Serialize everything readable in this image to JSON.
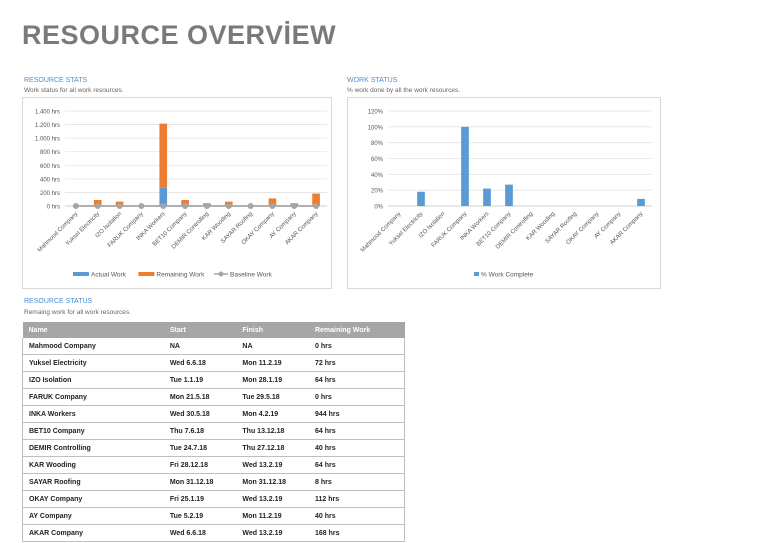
{
  "title": "RESOURCE OVERVİEW",
  "resource_stats": {
    "heading": "RESOURCE STATS",
    "subtitle": "Work status for all work resources."
  },
  "work_status": {
    "heading": "WORK STATUS",
    "subtitle": "% work done by all the work resources."
  },
  "resource_status": {
    "heading": "RESOURCE STATUS",
    "subtitle": "Remaing work for all work resources.",
    "columns": [
      "Name",
      "Start",
      "Finish",
      "Remaining Work"
    ],
    "rows": [
      [
        "Mahmood Company",
        "NA",
        "NA",
        "0 hrs"
      ],
      [
        "Yuksel Electricity",
        "Wed 6.6.18",
        "Mon 11.2.19",
        "72 hrs"
      ],
      [
        "IZO Isolation",
        "Tue 1.1.19",
        "Mon 28.1.19",
        "64 hrs"
      ],
      [
        "FARUK Company",
        "Mon 21.5.18",
        "Tue 29.5.18",
        "0 hrs"
      ],
      [
        "INKA Workers",
        "Wed 30.5.18",
        "Mon 4.2.19",
        "944 hrs"
      ],
      [
        "BET10 Company",
        "Thu 7.6.18",
        "Thu 13.12.18",
        "64 hrs"
      ],
      [
        "DEMIR Controlling",
        "Tue 24.7.18",
        "Thu 27.12.18",
        "40 hrs"
      ],
      [
        "KAR Wooding",
        "Fri 28.12.18",
        "Wed 13.2.19",
        "64 hrs"
      ],
      [
        "SAYAR Roofing",
        "Mon 31.12.18",
        "Mon 31.12.18",
        "8 hrs"
      ],
      [
        "OKAY Company",
        "Fri 25.1.19",
        "Wed 13.2.19",
        "112 hrs"
      ],
      [
        "AY Company",
        "Tue 5.2.19",
        "Mon 11.2.19",
        "40 hrs"
      ],
      [
        "AKAR Company",
        "Wed 6.6.18",
        "Wed 13.2.19",
        "168 hrs"
      ]
    ]
  },
  "chart_data": [
    {
      "type": "bar",
      "stacked": true,
      "categories": [
        "Mahmood Company",
        "Yuksel Electricity",
        "IZO Isolation",
        "FARUK Company",
        "INKA Workers",
        "BET10 Company",
        "DEMIR Controlling",
        "KAR Wooding",
        "SAYAR Roofing",
        "OKAY Company",
        "AY Company",
        "AKAR Company"
      ],
      "series": [
        {
          "name": "Actual Work",
          "color": "#5b9bd5",
          "values": [
            0,
            16,
            0,
            0,
            270,
            24,
            0,
            0,
            0,
            0,
            0,
            16
          ]
        },
        {
          "name": "Remaining Work",
          "color": "#ed7d31",
          "values": [
            0,
            72,
            64,
            0,
            944,
            64,
            40,
            64,
            8,
            112,
            40,
            168
          ]
        },
        {
          "name": "Baseline Work",
          "color": "#a5a5a5",
          "type": "line",
          "values": [
            0,
            0,
            0,
            0,
            0,
            0,
            0,
            0,
            0,
            0,
            0,
            0
          ]
        }
      ],
      "yticks": [
        "0 hrs",
        "200 hrs",
        "400 hrs",
        "600 hrs",
        "800 hrs",
        "1.000 hrs",
        "1.200 hrs",
        "1.400 hrs"
      ],
      "ylim": [
        0,
        1400
      ],
      "legend": "bottom"
    },
    {
      "type": "bar",
      "categories": [
        "Mahmood Company",
        "Yuksel Electricity",
        "IZO Isolation",
        "FARUK Company",
        "INKA Workers",
        "BET10 Company",
        "DEMIR Controlling",
        "KAR Wooding",
        "SAYAR Roofing",
        "OKAY Company",
        "AY Company",
        "AKAR Company"
      ],
      "series": [
        {
          "name": "% Work Complete",
          "color": "#5b9bd5",
          "values": [
            0,
            18,
            0,
            100,
            22,
            27,
            0,
            0,
            0,
            0,
            0,
            9
          ]
        }
      ],
      "yticks": [
        "0%",
        "20%",
        "40%",
        "60%",
        "80%",
        "100%",
        "120%"
      ],
      "ylim": [
        0,
        120
      ],
      "legend": "bottom"
    }
  ]
}
